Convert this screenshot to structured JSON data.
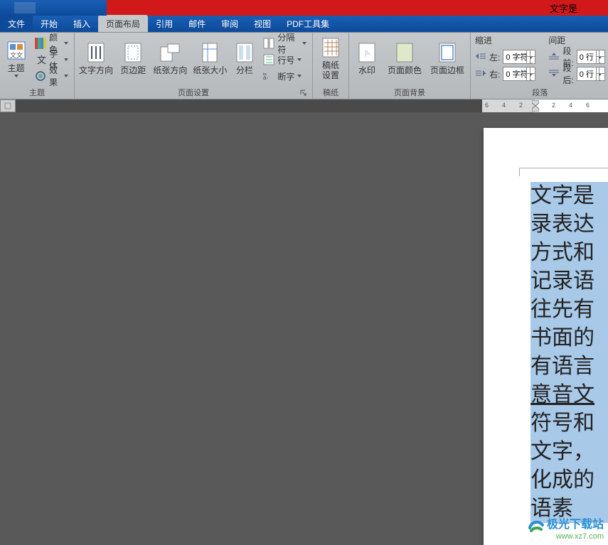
{
  "title": "文字是",
  "tabs": {
    "file": "文件",
    "home": "开始",
    "insert": "插入",
    "layout": "页面布局",
    "references": "引用",
    "mailings": "邮件",
    "review": "审阅",
    "view": "视图",
    "pdf": "PDF工具集"
  },
  "ribbon": {
    "theme_group": "主题",
    "page_setup_group": "页面设置",
    "draft_group": "稿纸",
    "page_bg_group": "页面背景",
    "paragraph_group": "段落",
    "theme_btn": "主题",
    "colors": "颜色",
    "fonts": "字体",
    "effects": "效果",
    "text_direction": "文字方向",
    "margins": "页边距",
    "orientation": "纸张方向",
    "size": "纸张大小",
    "columns": "分栏",
    "breaks": "分隔符",
    "line_numbers": "行号",
    "hyphenation": "断字",
    "draft_settings": "稿纸\n设置",
    "watermark": "水印",
    "page_color": "页面颜色",
    "page_border": "页面边框",
    "indent_title": "缩进",
    "indent_left": "左:",
    "indent_right": "右:",
    "indent_left_val": "0 字符",
    "indent_right_val": "0 字符",
    "spacing_title": "间距",
    "spacing_before": "段前:",
    "spacing_after": "段后:",
    "spacing_before_val": "0 行",
    "spacing_after_val": "0 行"
  },
  "ruler": {
    "marks": [
      "6",
      "4",
      "2",
      "",
      "2",
      "4",
      "6"
    ]
  },
  "document": {
    "lines": [
      "文字是",
      "录表达",
      "方式和",
      "记录语",
      "往先有",
      "书面的",
      "有语言",
      "意音文",
      "符号和",
      "文字，",
      "化成的",
      "语素"
    ],
    "link_index": 7
  },
  "watermark_logo": "极光下载站",
  "watermark_url": "www.xz7.com"
}
